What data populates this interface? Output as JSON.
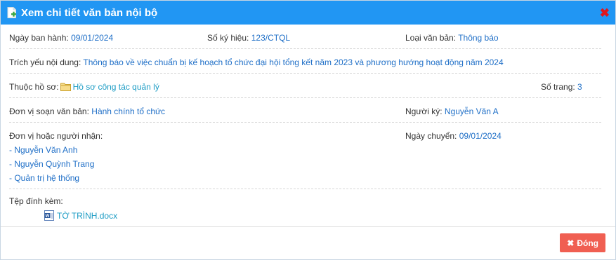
{
  "dialog": {
    "title": "Xem chi tiết văn bản nội bộ",
    "close_glyph": "✖"
  },
  "fields": {
    "ngay_ban_hanh": {
      "label": "Ngày ban hành:",
      "value": "09/01/2024"
    },
    "so_ky_hieu": {
      "label": "Số ký hiệu:",
      "value": "123/CTQL"
    },
    "loai_van_ban": {
      "label": "Loại văn bản:",
      "value": "Thông báo"
    },
    "trich_yeu": {
      "label": "Trích yếu nội dung:",
      "value": "Thông báo về việc chuẩn bị kế hoạch tổ chức đại hội tổng kết năm 2023 và phương hướng hoạt động năm 2024"
    },
    "thuoc_ho_so": {
      "label": "Thuộc hồ sơ:",
      "value": "Hồ sơ công tác quản lý"
    },
    "so_trang": {
      "label": "Số trang:",
      "value": "3"
    },
    "don_vi_soan": {
      "label": "Đơn vị soạn văn bản:",
      "value": "Hành chính tổ chức"
    },
    "nguoi_ky": {
      "label": "Người ký:",
      "value": "Nguyễn Văn A"
    },
    "nguoi_nhan": {
      "label": "Đơn vị hoặc người nhận:",
      "items": [
        "- Nguyễn Văn Anh",
        "- Nguyễn Quỳnh Trang",
        "- Quản trị hệ thống"
      ]
    },
    "ngay_chuyen": {
      "label": "Ngày chuyển:",
      "value": "09/01/2024"
    },
    "tep_dinh_kem": {
      "label": "Tệp đính kèm:",
      "file": "TỜ TRÌNH.docx"
    }
  },
  "footer": {
    "close_label": "Đóng",
    "close_glyph": "✖"
  },
  "colors": {
    "header": "#2196f3",
    "value": "#1f6fc7",
    "link": "#1a9bc4",
    "close_button": "#f05f52",
    "close_icon": "#e0161b"
  },
  "icons": {
    "title": "document-add-icon",
    "folder": "folder-icon",
    "file": "word-file-icon"
  }
}
